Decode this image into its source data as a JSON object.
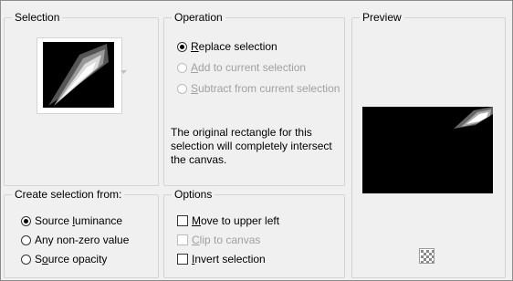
{
  "groups": {
    "selection": {
      "title": "Selection"
    },
    "operation": {
      "title": "Operation"
    },
    "preview": {
      "title": "Preview"
    },
    "create_from": {
      "title": "Create selection from:"
    },
    "options": {
      "title": "Options"
    }
  },
  "operation": {
    "replace": {
      "pre": "",
      "key": "R",
      "post": "eplace selection",
      "checked": true,
      "enabled": true
    },
    "add": {
      "pre": "",
      "key": "A",
      "post": "dd to current selection",
      "checked": false,
      "enabled": false
    },
    "subtract": {
      "pre": "",
      "key": "S",
      "post": "ubtract from current selection",
      "checked": false,
      "enabled": false
    },
    "message": "The original rectangle for this selection will completely intersect the canvas."
  },
  "create_from": {
    "source_luminance": {
      "pre": "Source ",
      "key": "l",
      "post": "uminance",
      "checked": true
    },
    "any_non_zero": {
      "pre": "Any non-zero value",
      "key": "",
      "post": "",
      "checked": false
    },
    "source_opacity": {
      "pre": "S",
      "key": "o",
      "post": "urce opacity",
      "checked": false
    }
  },
  "options": {
    "move_upper_left": {
      "pre": "",
      "key": "M",
      "post": "ove to upper left",
      "checked": false,
      "enabled": true
    },
    "clip_to_canvas": {
      "pre": "",
      "key": "C",
      "post": "lip to canvas",
      "checked": false,
      "enabled": false
    },
    "invert_selection": {
      "pre": "",
      "key": "I",
      "post": "nvert selection",
      "checked": false,
      "enabled": true
    }
  },
  "icons": {
    "dropdown": "chevron-down-icon",
    "preview_toggle": "checkerboard-icon"
  },
  "colors": {
    "group_border": "#d4d4d4",
    "disabled_text": "#a0a0a0",
    "preview_bg": "#000000"
  }
}
